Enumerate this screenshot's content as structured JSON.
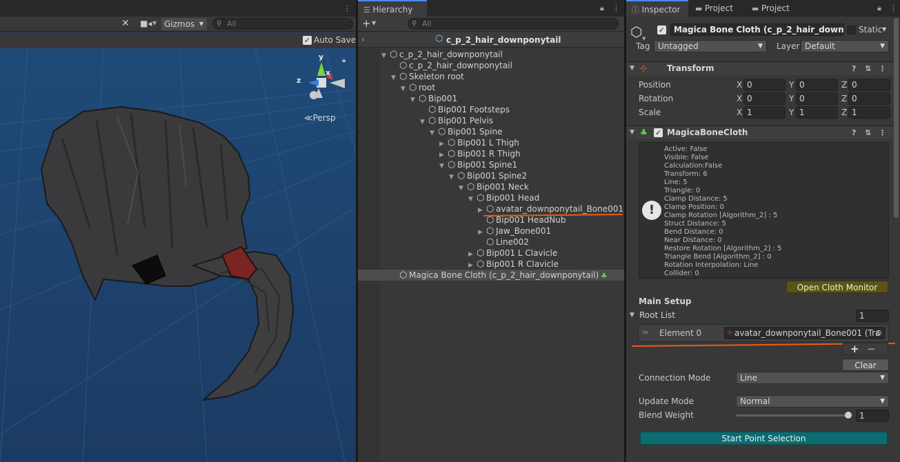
{
  "scene": {
    "gizmos_label": "Gizmos",
    "search_placeholder": "All",
    "auto_save_label": "Auto Save",
    "auto_save_checked": true,
    "persp_label": "Persp",
    "axis_y": "y",
    "axis_x": "x",
    "axis_z": "z"
  },
  "hierarchy": {
    "tab_label": "Hierarchy",
    "search_placeholder": "All",
    "scene_title": "c_p_2_hair_downponytail",
    "items": [
      {
        "label": "c_p_2_hair_downponytail",
        "depth": 0,
        "arrow": "▼"
      },
      {
        "label": "c_p_2_hair_downponytail",
        "depth": 1,
        "arrow": ""
      },
      {
        "label": "Skeleton root",
        "depth": 1,
        "arrow": "▼"
      },
      {
        "label": "root",
        "depth": 2,
        "arrow": "▼"
      },
      {
        "label": "Bip001",
        "depth": 3,
        "arrow": "▼"
      },
      {
        "label": "Bip001 Footsteps",
        "depth": 4,
        "arrow": ""
      },
      {
        "label": "Bip001 Pelvis",
        "depth": 4,
        "arrow": "▼"
      },
      {
        "label": "Bip001 Spine",
        "depth": 5,
        "arrow": "▼"
      },
      {
        "label": "Bip001 L Thigh",
        "depth": 6,
        "arrow": "▶"
      },
      {
        "label": "Bip001 R Thigh",
        "depth": 6,
        "arrow": "▶"
      },
      {
        "label": "Bip001 Spine1",
        "depth": 6,
        "arrow": "▼"
      },
      {
        "label": "Bip001 Spine2",
        "depth": 7,
        "arrow": "▼"
      },
      {
        "label": "Bip001 Neck",
        "depth": 8,
        "arrow": "▼"
      },
      {
        "label": "Bip001 Head",
        "depth": 9,
        "arrow": "▼"
      },
      {
        "label": "avatar_downponytail_Bone001",
        "depth": 10,
        "arrow": "▶"
      },
      {
        "label": "Bip001 HeadNub",
        "depth": 10,
        "arrow": ""
      },
      {
        "label": "Jaw_Bone001",
        "depth": 10,
        "arrow": "▶"
      },
      {
        "label": "Line002",
        "depth": 10,
        "arrow": ""
      },
      {
        "label": "Bip001 L Clavicle",
        "depth": 9,
        "arrow": "▶"
      },
      {
        "label": "Bip001 R Clavicle",
        "depth": 9,
        "arrow": "▶"
      },
      {
        "label": "Magica Bone Cloth (c_p_2_hair_downponytail)",
        "depth": 1,
        "arrow": ""
      }
    ]
  },
  "inspector": {
    "tabs": [
      "Inspector",
      "Project",
      "Project"
    ],
    "object_name": "Magica Bone Cloth (c_p_2_hair_downpony",
    "static_label": "Static",
    "tag_label": "Tag",
    "tag_value": "Untagged",
    "layer_label": "Layer",
    "layer_value": "Default",
    "transform": {
      "title": "Transform",
      "rows": [
        {
          "label": "Position",
          "x": "0",
          "y": "0",
          "z": "0"
        },
        {
          "label": "Rotation",
          "x": "0",
          "y": "0",
          "z": "0"
        },
        {
          "label": "Scale",
          "x": "1",
          "y": "1",
          "z": "1"
        }
      ],
      "axis_x": "X",
      "axis_y": "Y",
      "axis_z": "Z"
    },
    "bonecloth": {
      "title": "MagicaBoneCloth",
      "status_lines": [
        "Active: False",
        "Visible: False",
        "Calculation:False",
        "Transform: 6",
        "Line: 5",
        "Triangle: 0",
        "Clamp Distance: 5",
        "Clamp Position: 0",
        "Clamp Rotation [Algorithm_2] : 5",
        "Struct Distance: 5",
        "Bend Distance: 0",
        "Near Distance: 0",
        "Restore Rotation [Algorithm_2] : 5",
        "Triangle Bend [Algorithm_2] : 0",
        "Rotation Interpolation: Line",
        "Collider: 0"
      ],
      "open_monitor_label": "Open Cloth Monitor",
      "main_setup_label": "Main Setup",
      "root_list_label": "Root List",
      "root_list_count": "1",
      "element_label": "Element 0",
      "element_value": "avatar_downponytail_Bone001 (Tra",
      "plus_label": "+",
      "minus_label": "−",
      "clear_label": "Clear",
      "connection_mode_label": "Connection Mode",
      "connection_mode_value": "Line",
      "update_mode_label": "Update Mode",
      "update_mode_value": "Normal",
      "blend_weight_label": "Blend Weight",
      "blend_weight_value": "1",
      "start_point_label": "Start Point Selection"
    }
  }
}
